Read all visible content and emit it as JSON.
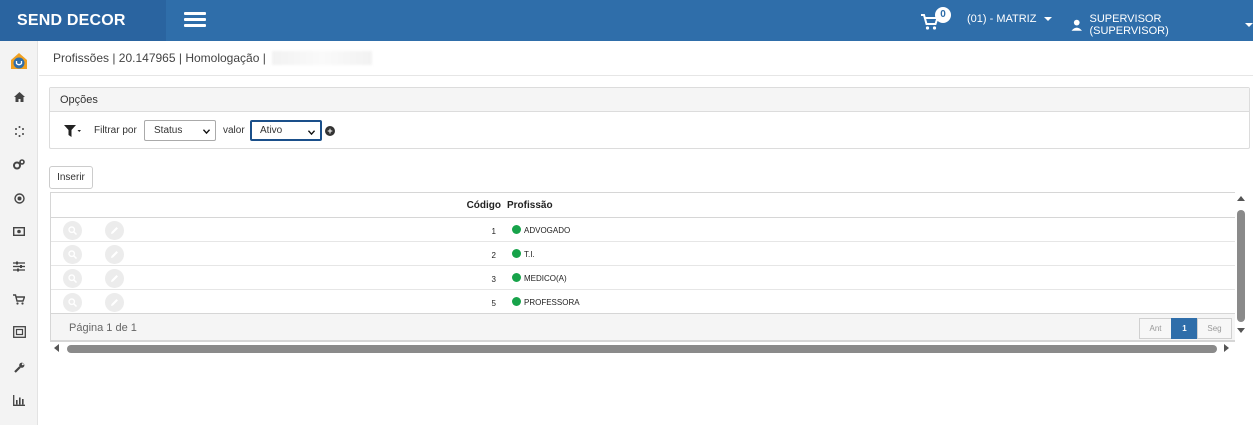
{
  "app": {
    "brand": "SEND DECOR"
  },
  "header": {
    "cart_count": "0",
    "company_menu": "(01) - MATRIZ",
    "user_menu": "SUPERVISOR (SUPERVISOR)"
  },
  "breadcrumb": "Profissões | 20.147965 | Homologação |",
  "options": {
    "title": "Opções",
    "filter_label": "Filtrar por",
    "filter_field": "Status",
    "value_label": "valor",
    "filter_value": "Ativo"
  },
  "actions": {
    "insert_label": "Inserir"
  },
  "table": {
    "headers": {
      "code": "Código",
      "profession": "Profissão"
    },
    "rows": [
      {
        "code": "1",
        "name": "ADVOGADO",
        "status": "Ativo"
      },
      {
        "code": "2",
        "name": "T.I.",
        "status": "Ativo"
      },
      {
        "code": "3",
        "name": "MEDICO(A)",
        "status": "Ativo"
      },
      {
        "code": "5",
        "name": "PROFESSORA",
        "status": "Ativo"
      }
    ],
    "status_color": "#17a34a"
  },
  "pager": {
    "text": "Página 1 de 1",
    "prev": "Ant",
    "current": "1",
    "next": "Seg"
  },
  "colors": {
    "header_bg": "#2f6eaa",
    "brand_bg": "#2a64a0"
  }
}
